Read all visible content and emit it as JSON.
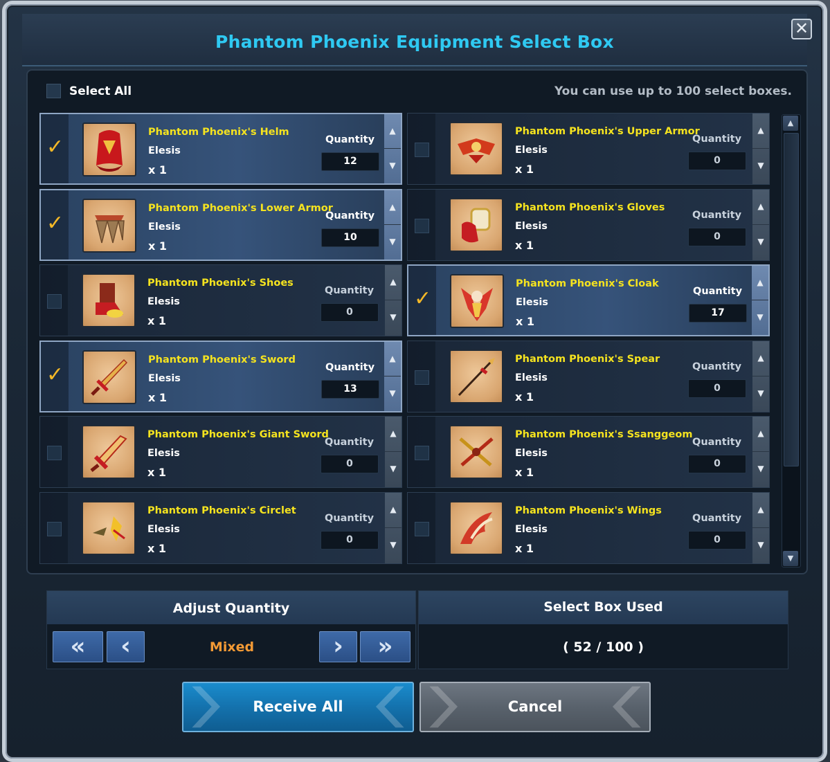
{
  "dialog": {
    "title": "Phantom Phoenix Equipment Select Box",
    "close_icon": "✕",
    "select_all_label": "Select All",
    "limit_note": "You can use up to 100 select boxes."
  },
  "quantity_label": "Quantity",
  "items": [
    {
      "name": "Phantom Phoenix's Helm",
      "character": "Elesis",
      "count": "x 1",
      "quantity": "12",
      "selected": true,
      "icon": "helm-icon"
    },
    {
      "name": "Phantom Phoenix's Upper Armor",
      "character": "Elesis",
      "count": "x 1",
      "quantity": "0",
      "selected": false,
      "icon": "upper-armor-icon"
    },
    {
      "name": "Phantom Phoenix's Lower Armor",
      "character": "Elesis",
      "count": "x 1",
      "quantity": "10",
      "selected": true,
      "icon": "lower-armor-icon"
    },
    {
      "name": "Phantom Phoenix's Gloves",
      "character": "Elesis",
      "count": "x 1",
      "quantity": "0",
      "selected": false,
      "icon": "gloves-icon"
    },
    {
      "name": "Phantom Phoenix's Shoes",
      "character": "Elesis",
      "count": "x 1",
      "quantity": "0",
      "selected": false,
      "icon": "shoes-icon"
    },
    {
      "name": "Phantom Phoenix's Cloak",
      "character": "Elesis",
      "count": "x 1",
      "quantity": "17",
      "selected": true,
      "icon": "cloak-icon"
    },
    {
      "name": "Phantom Phoenix's Sword",
      "character": "Elesis",
      "count": "x 1",
      "quantity": "13",
      "selected": true,
      "icon": "sword-icon"
    },
    {
      "name": "Phantom Phoenix's Spear",
      "character": "Elesis",
      "count": "x 1",
      "quantity": "0",
      "selected": false,
      "icon": "spear-icon"
    },
    {
      "name": "Phantom Phoenix's Giant Sword",
      "character": "Elesis",
      "count": "x 1",
      "quantity": "0",
      "selected": false,
      "icon": "giant-sword-icon"
    },
    {
      "name": "Phantom Phoenix's Ssanggeom",
      "character": "Elesis",
      "count": "x 1",
      "quantity": "0",
      "selected": false,
      "icon": "ssanggeom-icon"
    },
    {
      "name": "Phantom Phoenix's Circlet",
      "character": "Elesis",
      "count": "x 1",
      "quantity": "0",
      "selected": false,
      "icon": "circlet-icon"
    },
    {
      "name": "Phantom Phoenix's Wings",
      "character": "Elesis",
      "count": "x 1",
      "quantity": "0",
      "selected": false,
      "icon": "wings-icon"
    }
  ],
  "adjust": {
    "title": "Adjust Quantity",
    "value": "Mixed",
    "first_icon": "«",
    "prev_icon": "‹",
    "next_icon": "›",
    "last_icon": "»"
  },
  "used": {
    "title": "Select Box Used",
    "value": "( 52 / 100 )"
  },
  "buttons": {
    "receive_all": "Receive All",
    "cancel": "Cancel"
  },
  "colors": {
    "title": "#2fc9f2",
    "item_name": "#f5e31f",
    "checkmark": "#f4b827",
    "mixed": "#f39a35",
    "receive_button": "#1a8ccd",
    "cancel_button": "#6d7681"
  }
}
